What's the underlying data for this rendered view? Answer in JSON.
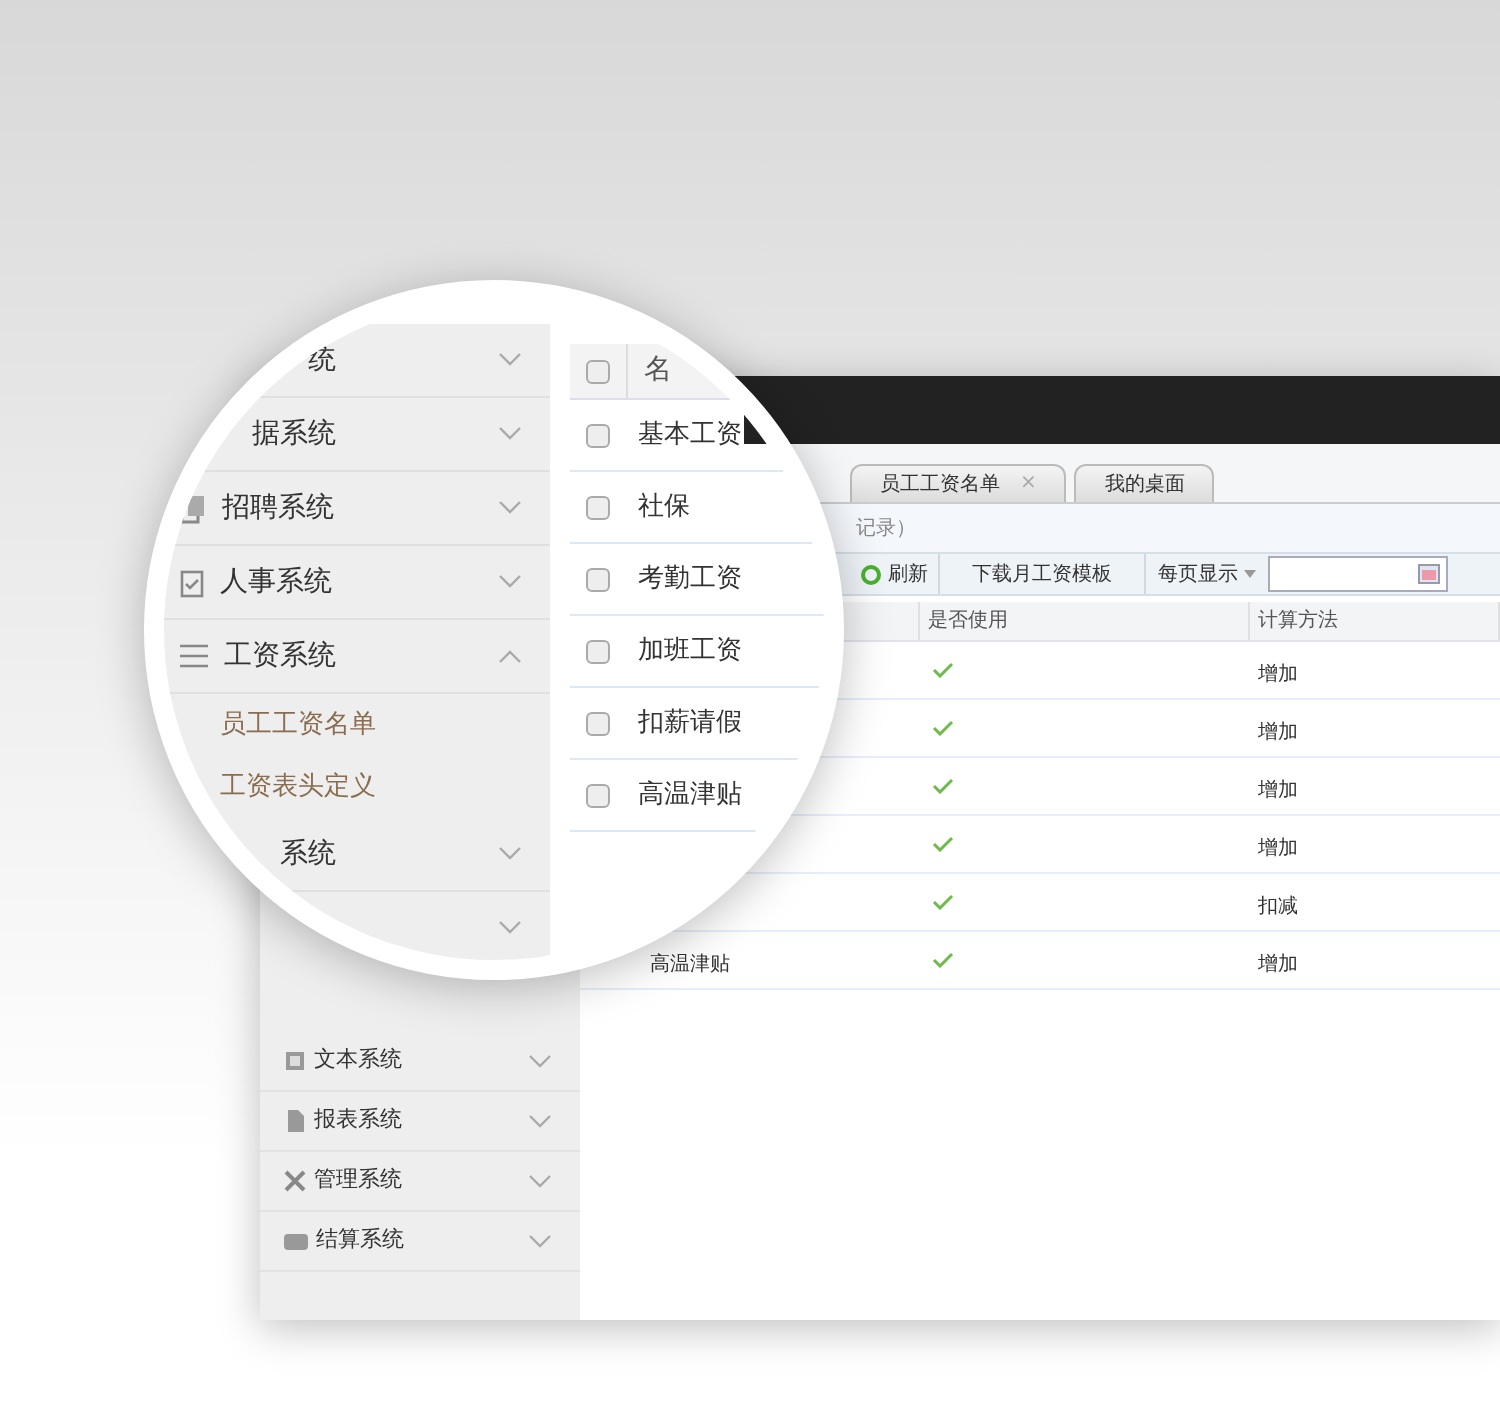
{
  "app": {
    "tabs": [
      {
        "label": "员工工资名单",
        "close": "×"
      },
      {
        "label": "我的桌面"
      }
    ],
    "breadcrumb": "记录）",
    "toolbar": {
      "refresh": "刷新",
      "download": "下载月工资模板",
      "page_size": "每页显示"
    },
    "table": {
      "columns": [
        "是否使用",
        "计算方法"
      ],
      "rows": [
        {
          "used": true,
          "method": "增加"
        },
        {
          "used": true,
          "method": "增加"
        },
        {
          "used": true,
          "method": "增加"
        },
        {
          "used": true,
          "method": "增加"
        },
        {
          "used": true,
          "method": "扣减"
        },
        {
          "name": "高温津贴",
          "used": true,
          "method": "增加"
        }
      ]
    },
    "sidebar": [
      {
        "label": "文本系统"
      },
      {
        "label": "报表系统"
      },
      {
        "label": "管理系统"
      },
      {
        "label": "结算系统"
      }
    ]
  },
  "magnifier": {
    "sidebar": [
      {
        "label": "统",
        "expanded": false
      },
      {
        "label": "据系统",
        "expanded": false
      },
      {
        "label": "招聘系统",
        "expanded": false
      },
      {
        "label": "人事系统",
        "expanded": false
      },
      {
        "label": "工资系统",
        "expanded": true,
        "children": [
          "员工工资名单",
          "工资表头定义"
        ]
      },
      {
        "label": "系统",
        "expanded": false
      },
      {
        "expanded": false
      }
    ],
    "table": {
      "column": "名",
      "header_checked": false,
      "rows": [
        {
          "name": "基本工资",
          "checked": false
        },
        {
          "name": "社保",
          "checked": false
        },
        {
          "name": "考勤工资",
          "checked": false
        },
        {
          "name": "加班工资",
          "checked": false
        },
        {
          "name": "扣薪请假",
          "checked": false
        },
        {
          "name": "高温津贴",
          "checked": false
        }
      ]
    }
  }
}
